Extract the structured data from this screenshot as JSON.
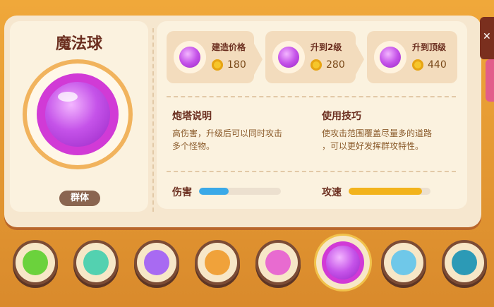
{
  "tower": {
    "name": "魔法球",
    "badge": "群体"
  },
  "upgrades": [
    {
      "title": "建造价格",
      "price": "180"
    },
    {
      "title": "升到2级",
      "price": "280"
    },
    {
      "title": "升到顶级",
      "price": "440"
    }
  ],
  "description": {
    "title": "炮塔说明",
    "text_line1": "高伤害，升级后可以同时攻击",
    "text_line2": "多个怪物。"
  },
  "tips": {
    "title": "使用技巧",
    "text_line1": "使攻击范围覆盖尽量多的道路",
    "text_line2": "，可以更好发挥群攻特性。"
  },
  "stats": {
    "damage_label": "伤害",
    "damage_level": 0.36,
    "attack_speed_label": "攻速",
    "attack_speed_level": 0.9
  },
  "bottom_icons": [
    {
      "name": "green-bottle-icon",
      "color": "#6bd23c"
    },
    {
      "name": "clover-icon",
      "color": "#53d1b0"
    },
    {
      "name": "potion-flask-icon",
      "color": "#a86af2"
    },
    {
      "name": "rocket-icon",
      "color": "#f0a23a"
    },
    {
      "name": "pink-bottle-icon",
      "color": "#e86bd0"
    },
    {
      "name": "magic-orb-icon",
      "color": "#c553e9",
      "selected": true
    },
    {
      "name": "syringe-icon",
      "color": "#6fc8e9"
    },
    {
      "name": "crossbow-icon",
      "color": "#2c9ab6"
    }
  ],
  "colors": {
    "damage_bar": "#3aa9e8",
    "speed_bar": "#f2b31c",
    "title_text": "#6b2e1f"
  }
}
